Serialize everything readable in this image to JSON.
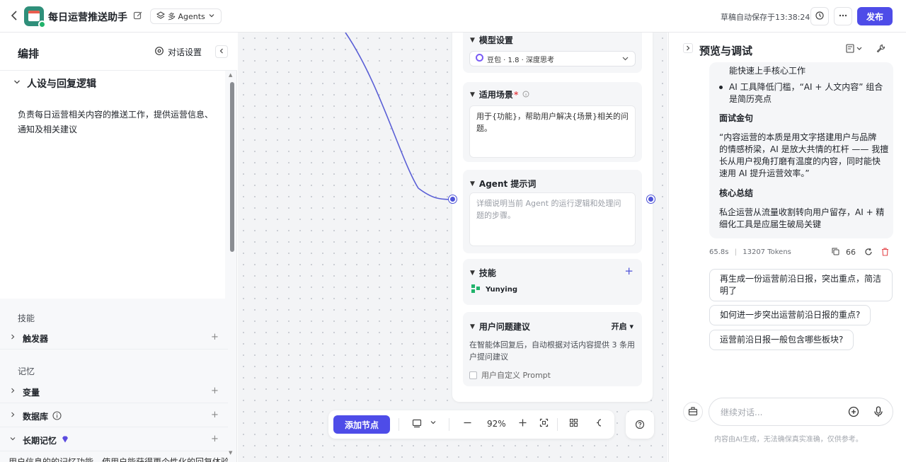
{
  "topbar": {
    "title": "每日运营推送助手",
    "agents_mode": "多 Agents",
    "autosave": "草稿自动保存于13:38:24",
    "publish": "发布"
  },
  "left": {
    "title": "编排",
    "dialog_settings": "对话设置",
    "persona_title": "人设与回复逻辑",
    "persona_text": "负责每日运营相关内容的推送工作，提供运营信息、通知及相关建议",
    "skills_label": "技能",
    "trigger": "触发器",
    "memory_label": "记忆",
    "variables": "变量",
    "database": "数据库",
    "long_memory": "长期记忆",
    "cut_text": "用户信息的的记忆功能，使用户能获得更个性化的回复体验"
  },
  "canvas": {
    "model_settings": "模型设置",
    "model_name": "豆包 · 1.8 · 深度思考",
    "scenario_title": "适用场景",
    "scenario_text": "用于{功能}，帮助用户解决{场景}相关的问题。",
    "prompt_title": "Agent 提示词",
    "prompt_placeholder": "详细说明当前 Agent 的运行逻辑和处理问题的步骤。",
    "skills_title": "技能",
    "skill_name": "Yunying",
    "suggestion_title": "用户问题建议",
    "suggestion_state": "开启",
    "suggestion_desc": "在智能体回复后，自动根据对话内容提供 3 条用户提问建议",
    "custom_prompt": "用户自定义 Prompt",
    "add_node": "添加节点",
    "zoom": "92%"
  },
  "right": {
    "title": "预览与调试",
    "msg": {
      "line0": "能快速上手核心工作",
      "bullet1a": "AI 工具降低门槛，“AI + 人文内容” 组合",
      "bullet1b": "是简历亮点",
      "h1": "面试金句",
      "q1": "“内容运营的本质是用文字搭建用户与品牌",
      "q2": "的情感桥梁，AI 是放大共情的杠杆 —— 我擅",
      "q3": "长从用户视角打磨有温度的内容，同时能快",
      "q4": "速用 AI 提升运营效率。”",
      "h2": "核心总结",
      "s1": "私企运营从流量收割转向用户留存，AI + 精",
      "s2": "细化工具是应届生破局关键"
    },
    "meta_time": "65.8s",
    "meta_tokens": "13207 Tokens",
    "meta_sep": "|",
    "count": "66",
    "suggestions": [
      {
        "l1": "再生成一份运营前沿日报，突出重点，简洁",
        "l2": "明了"
      },
      {
        "l1": "如何进一步突出运营前沿日报的重点?",
        "l2": ""
      },
      {
        "l1": "运营前沿日报一般包含哪些板块?",
        "l2": ""
      }
    ],
    "input_placeholder": "继续对话...",
    "disclaimer": "内容由AI生成，无法确保真实准确，仅供参考。"
  },
  "colors": {
    "accent": "#4e4ce8",
    "port": "#4e53d8",
    "delete": "#e5484d"
  }
}
